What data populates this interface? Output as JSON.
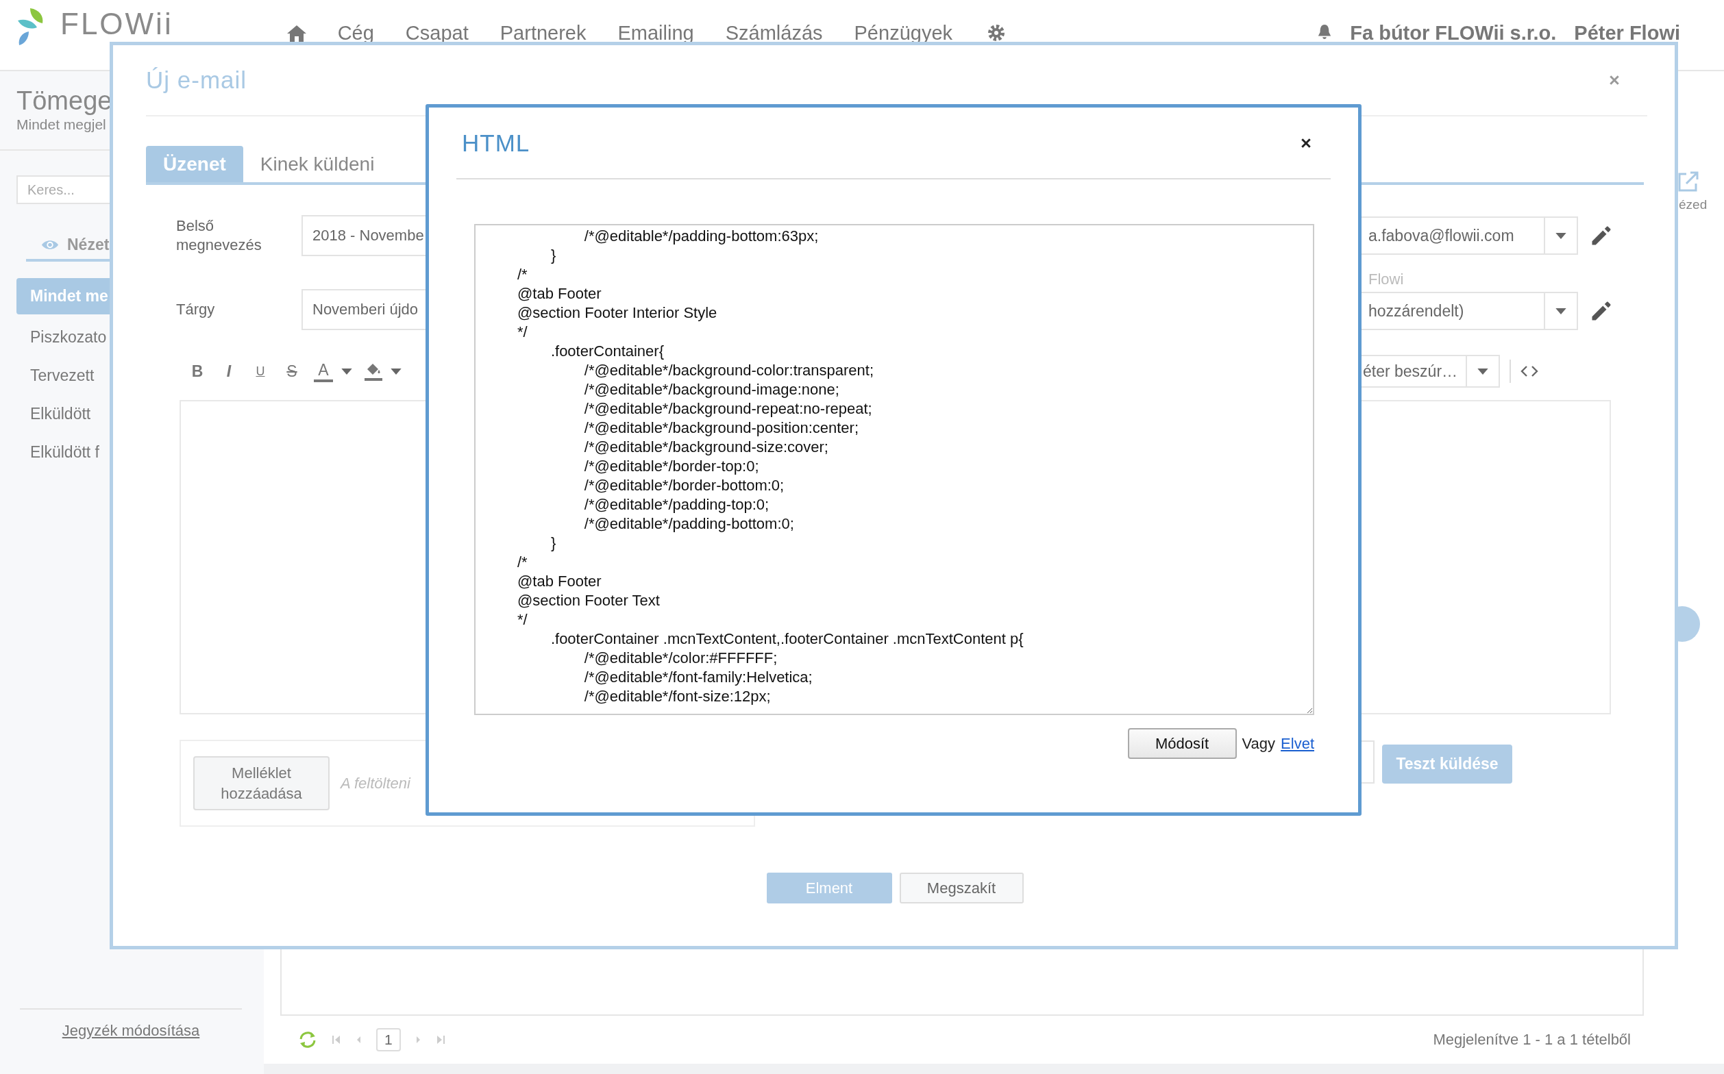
{
  "nav": {
    "logo": "FLOWii",
    "items": [
      "Cég",
      "Csapat",
      "Partnerek",
      "Emailing",
      "Számlázás",
      "Pénzügyek"
    ],
    "company": "Fa bútor FLOWii s.r.o.",
    "user": "Péter Flowi"
  },
  "sidebar": {
    "title": "Tömege",
    "subtitle": "Mindet megjel",
    "search": {
      "placeholder": "Keres..."
    },
    "view_tab": "Nézet",
    "items": [
      {
        "label": "Mindet me",
        "selected": true
      },
      {
        "label": "Piszkozato",
        "selected": false
      },
      {
        "label": "Tervezett",
        "selected": false
      },
      {
        "label": "Elküldött",
        "selected": false
      },
      {
        "label": "Elküldött f",
        "selected": false
      }
    ],
    "footer_link": "Jegyzék módosítása"
  },
  "pager": {
    "page": "1",
    "summary": "Megjelenítve 1 - 1 a 1 tételből"
  },
  "side_action": "ézed",
  "email_dialog": {
    "title": "Új e-mail",
    "tabs": [
      {
        "label": "Üzenet",
        "selected": true
      },
      {
        "label": "Kinek küldeni",
        "selected": false
      }
    ],
    "fields": [
      {
        "label": "Belső megnevezés",
        "value": "2018 - Novembe"
      },
      {
        "label": "Tárgy",
        "value": "Novemberi újdo"
      }
    ],
    "sender": {
      "value": "a.fabova@flowii.com"
    },
    "sender_name": "Flowi",
    "assignee": {
      "value": "hozzárendelt)"
    },
    "toolbar": [
      {
        "kind": "bold",
        "glyph": "B"
      },
      {
        "kind": "italic",
        "glyph": "I"
      },
      {
        "kind": "underline",
        "glyph": "U"
      },
      {
        "kind": "strike",
        "glyph": "S"
      },
      {
        "kind": "color",
        "glyph": "A"
      },
      {
        "kind": "fill"
      }
    ],
    "insert_parameter": {
      "value": "éter beszúr…"
    },
    "attachment": {
      "button": "Melléklet hozzáadása",
      "hint": "A feltölteni"
    },
    "test_button": "Teszt küldése",
    "save_button": "Elment",
    "cancel_button": "Megszakít"
  },
  "html_dialog": {
    "title": "HTML",
    "code": "\t\t/*@editable*/padding-bottom:63px;\n\t}\n/*\n@tab Footer\n@section Footer Interior Style\n*/\n\t.footerContainer{\n\t\t/*@editable*/background-color:transparent;\n\t\t/*@editable*/background-image:none;\n\t\t/*@editable*/background-repeat:no-repeat;\n\t\t/*@editable*/background-position:center;\n\t\t/*@editable*/background-size:cover;\n\t\t/*@editable*/border-top:0;\n\t\t/*@editable*/border-bottom:0;\n\t\t/*@editable*/padding-top:0;\n\t\t/*@editable*/padding-bottom:0;\n\t}\n/*\n@tab Footer\n@section Footer Text\n*/\n\t.footerContainer .mcnTextContent,.footerContainer .mcnTextContent p{\n\t\t/*@editable*/color:#FFFFFF;\n\t\t/*@editable*/font-family:Helvetica;\n\t\t/*@editable*/font-size:12px;",
    "apply_button": "Módosít",
    "or_text": "Vagy",
    "discard_link": "Elvet"
  }
}
